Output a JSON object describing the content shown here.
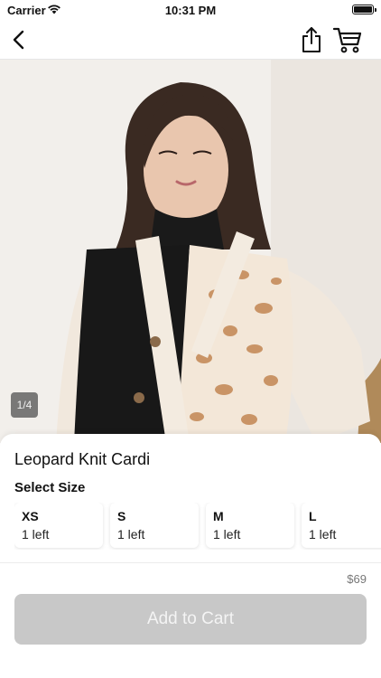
{
  "status_bar": {
    "carrier": "Carrier",
    "time": "10:31 PM"
  },
  "nav": {
    "back_icon": "chevron-left-icon",
    "share_icon": "share-icon",
    "cart_icon": "cart-icon"
  },
  "gallery": {
    "counter": "1/4"
  },
  "product": {
    "title": "Leopard Knit Cardi",
    "size_heading": "Select Size",
    "sizes": [
      {
        "label": "XS",
        "stock": "1 left"
      },
      {
        "label": "S",
        "stock": "1 left"
      },
      {
        "label": "M",
        "stock": "1 left"
      },
      {
        "label": "L",
        "stock": "1 left"
      }
    ]
  },
  "checkout": {
    "price": "$69",
    "add_to_cart_label": "Add to Cart",
    "button_color": "#c8c8c8"
  }
}
